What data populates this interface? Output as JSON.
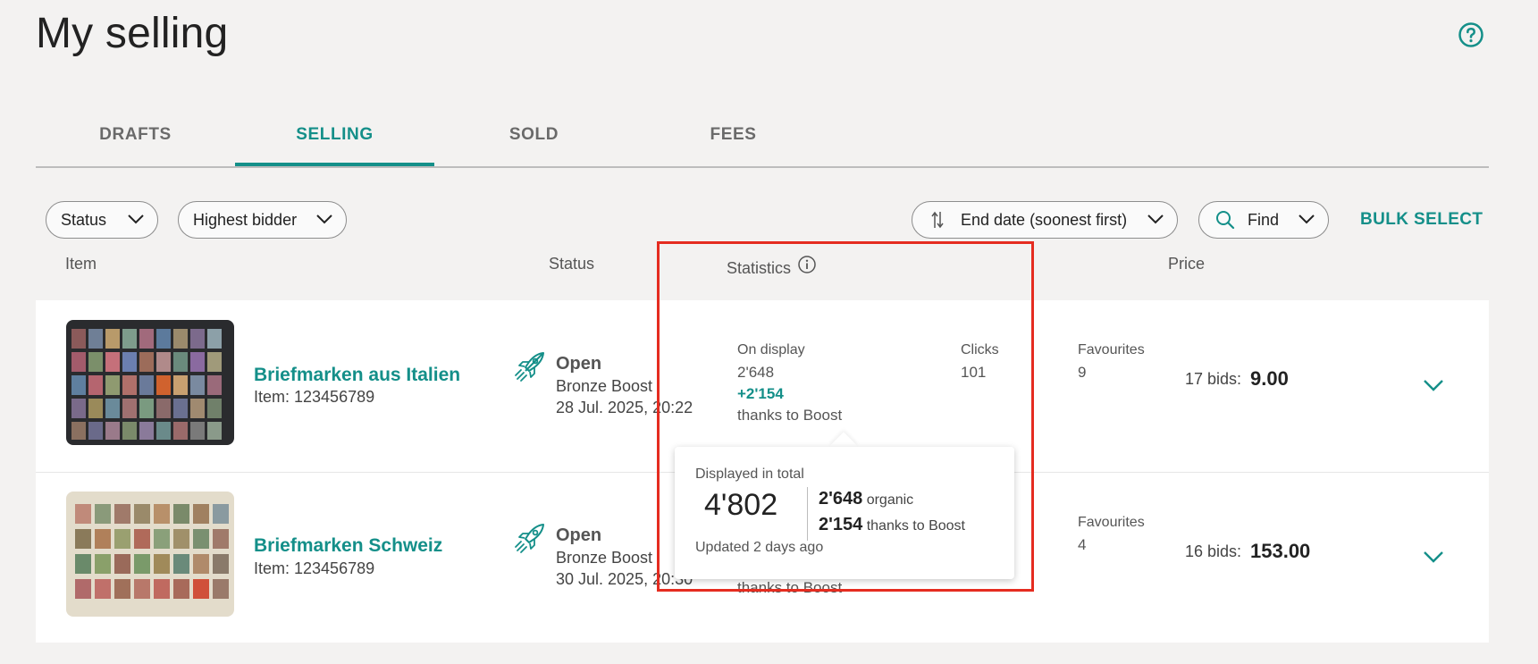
{
  "page": {
    "title": "My selling"
  },
  "tabs": [
    {
      "label": "DRAFTS",
      "active": false
    },
    {
      "label": "SELLING",
      "active": true
    },
    {
      "label": "SOLD",
      "active": false
    },
    {
      "label": "FEES",
      "active": false
    }
  ],
  "filters": {
    "status_label": "Status",
    "bidder_label": "Highest bidder",
    "sort_label": "End date (soonest first)",
    "find_label": "Find",
    "bulk_select": "BULK SELECT"
  },
  "columns": {
    "item": "Item",
    "status": "Status",
    "statistics": "Statistics",
    "price": "Price"
  },
  "rows": [
    {
      "title": "Briefmarken aus Italien",
      "item_id": "Item: 123456789",
      "status": "Open",
      "boost": "Bronze Boost",
      "end_date": "28 Jul. 2025, 20:22",
      "on_display_label": "On display",
      "on_display": "2'648",
      "boost_gain": "+2'154",
      "boost_note": "thanks to Boost",
      "clicks_label": "Clicks",
      "clicks": "101",
      "favourites_label": "Favourites",
      "favourites": "9",
      "bids": "17 bids:",
      "price": "9.00"
    },
    {
      "title": "Briefmarken Schweiz",
      "item_id": "Item: 123456789",
      "status": "Open",
      "boost": "Bronze Boost",
      "end_date": "30 Jul. 2025, 20:30",
      "boost_note": "thanks to Boost",
      "favourites_label": "Favourites",
      "favourites": "4",
      "bids": "16 bids:",
      "price": "153.00"
    }
  ],
  "popover": {
    "heading": "Displayed in total",
    "total": "4'802",
    "organic_value": "2'648",
    "organic_label": "organic",
    "boost_value": "2'154",
    "boost_label": "thanks to Boost",
    "updated": "Updated 2 days ago"
  },
  "colors": {
    "accent": "#148f89",
    "highlight": "#e52c20",
    "background": "#f3f2f1"
  }
}
